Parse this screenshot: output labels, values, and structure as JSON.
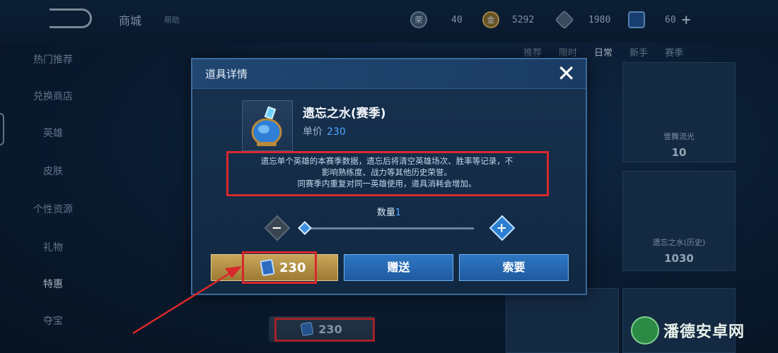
{
  "topbar": {
    "shop_title": "商城",
    "help_label": "帮助",
    "currencies": [
      {
        "icon": "honor-icon",
        "value": "40"
      },
      {
        "icon": "gold-coin-icon",
        "value": "5292"
      },
      {
        "icon": "gem-icon",
        "value": "1980"
      },
      {
        "icon": "coupon-icon",
        "value": "60"
      }
    ],
    "add_label": "+"
  },
  "sidebar": {
    "items": [
      "热门推荐",
      "兑换商店",
      "英雄",
      "皮肤",
      "个性资源",
      "礼物",
      "特惠",
      "夺宝"
    ],
    "active": "特惠"
  },
  "tabs": [
    "推荐",
    "限时",
    "日常",
    "新手",
    "赛季"
  ],
  "background_cards": [
    {
      "label": "雪舞流光",
      "price": "10"
    },
    {
      "label": "遗忘之水(历史)",
      "price": "1030"
    }
  ],
  "background_item": {
    "name": "遗忘之水(赛季)"
  },
  "bottom_price": "230",
  "modal": {
    "title": "道具详情",
    "close_label": "✕",
    "item_name": "遗忘之水(赛季)",
    "price_label": "单价",
    "price_value": "230",
    "description_lines": [
      "遗忘单个英雄的本赛季数据，遗忘后将清空英雄场次、胜率等记录，不",
      "影响熟练度、战力等其他历史荣誉。",
      "同赛季内重复对同一英雄使用，道具消耗会增加。"
    ],
    "quantity_label": "数量",
    "quantity_value": "1",
    "buy_price": "230",
    "gift_label": "赠送",
    "ask_label": "索要"
  },
  "watermark": {
    "text": "潘德安卓网"
  },
  "colors": {
    "highlight_red": "#d8282c",
    "accent_blue": "#4ea6ff",
    "gold": "#c8a65a"
  }
}
